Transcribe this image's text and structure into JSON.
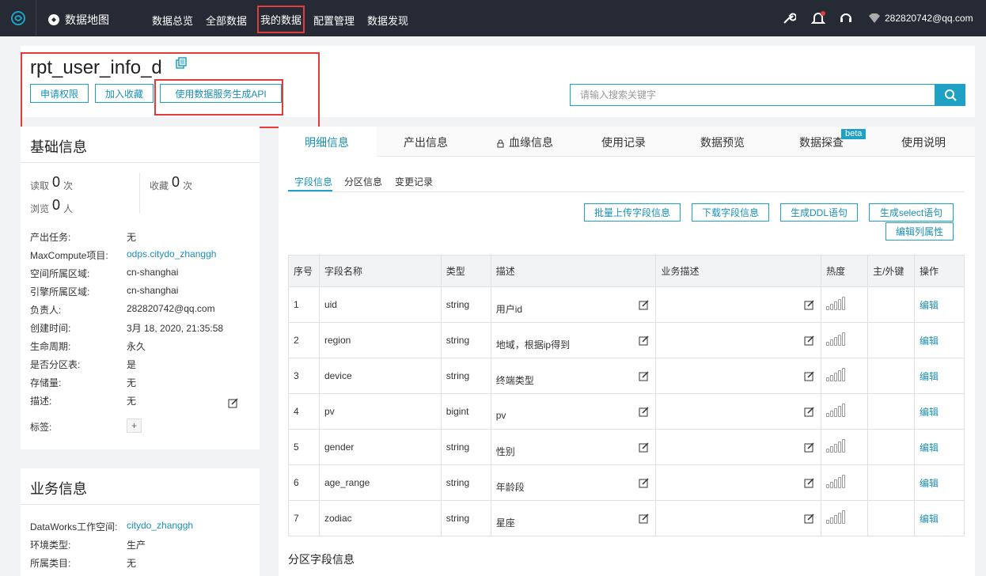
{
  "nav": {
    "brand": "数据地图",
    "items": [
      "数据总览",
      "全部数据",
      "我的数据",
      "配置管理",
      "数据发现"
    ],
    "user": "282820742@qq.com"
  },
  "header": {
    "table_name": "rpt_user_info_d",
    "buttons": [
      "申请权限",
      "加入收藏",
      "使用数据服务生成API"
    ],
    "search_placeholder": "请输入搜索关键字"
  },
  "basic": {
    "title": "基础信息",
    "read_label": "读取",
    "read_count": "0",
    "read_unit": "次",
    "fav_label": "收藏",
    "fav_count": "0",
    "fav_unit": "次",
    "view_label": "浏览",
    "view_count": "0",
    "view_unit": "人",
    "rows": [
      {
        "k": "产出任务:",
        "v": "无"
      },
      {
        "k": "MaxCompute项目:",
        "v": "odps.citydo_zhanggh"
      },
      {
        "k": "空间所属区域:",
        "v": "cn-shanghai"
      },
      {
        "k": "引擎所属区域:",
        "v": "cn-shanghai"
      },
      {
        "k": "负责人:",
        "v": "282820742@qq.com"
      },
      {
        "k": "创建时间:",
        "v": "3月 18, 2020, 21:35:58"
      },
      {
        "k": "生命周期:",
        "v": "永久"
      },
      {
        "k": "是否分区表:",
        "v": "是"
      },
      {
        "k": "存储量:",
        "v": "无"
      },
      {
        "k": "描述:",
        "v": "无"
      }
    ],
    "tags_label": "标签:",
    "add_tag": "+"
  },
  "business": {
    "title": "业务信息",
    "rows": [
      {
        "k": "DataWorks工作空间:",
        "v": "citydo_zhanggh"
      },
      {
        "k": "环境类型:",
        "v": "生产"
      },
      {
        "k": "所属类目:",
        "v": "无"
      }
    ]
  },
  "tabs": [
    "明细信息",
    "产出信息",
    "血缘信息",
    "使用记录",
    "数据预览",
    "数据探查",
    "使用说明"
  ],
  "beta": "beta",
  "subtabs": [
    "字段信息",
    "分区信息",
    "变更记录"
  ],
  "actions": [
    "批量上传字段信息",
    "下载字段信息",
    "生成DDL语句",
    "生成select语句",
    "编辑列属性"
  ],
  "table": {
    "headers": [
      "序号",
      "字段名称",
      "类型",
      "描述",
      "业务描述",
      "热度",
      "主/外键",
      "操作"
    ],
    "rows": [
      {
        "no": "1",
        "name": "uid",
        "type": "string",
        "desc": "用户id",
        "op": "编辑"
      },
      {
        "no": "2",
        "name": "region",
        "type": "string",
        "desc": "地域，根据ip得到",
        "op": "编辑"
      },
      {
        "no": "3",
        "name": "device",
        "type": "string",
        "desc": "终端类型",
        "op": "编辑"
      },
      {
        "no": "4",
        "name": "pv",
        "type": "bigint",
        "desc": "pv",
        "op": "编辑"
      },
      {
        "no": "5",
        "name": "gender",
        "type": "string",
        "desc": "性别",
        "op": "编辑"
      },
      {
        "no": "6",
        "name": "age_range",
        "type": "string",
        "desc": "年龄段",
        "op": "编辑"
      },
      {
        "no": "7",
        "name": "zodiac",
        "type": "string",
        "desc": "星座",
        "op": "编辑"
      }
    ]
  },
  "partition_title": "分区字段信息",
  "colors": {
    "accent": "#1ea1c4",
    "highlight": "#e23b3b",
    "nav_bg": "#262a34"
  }
}
